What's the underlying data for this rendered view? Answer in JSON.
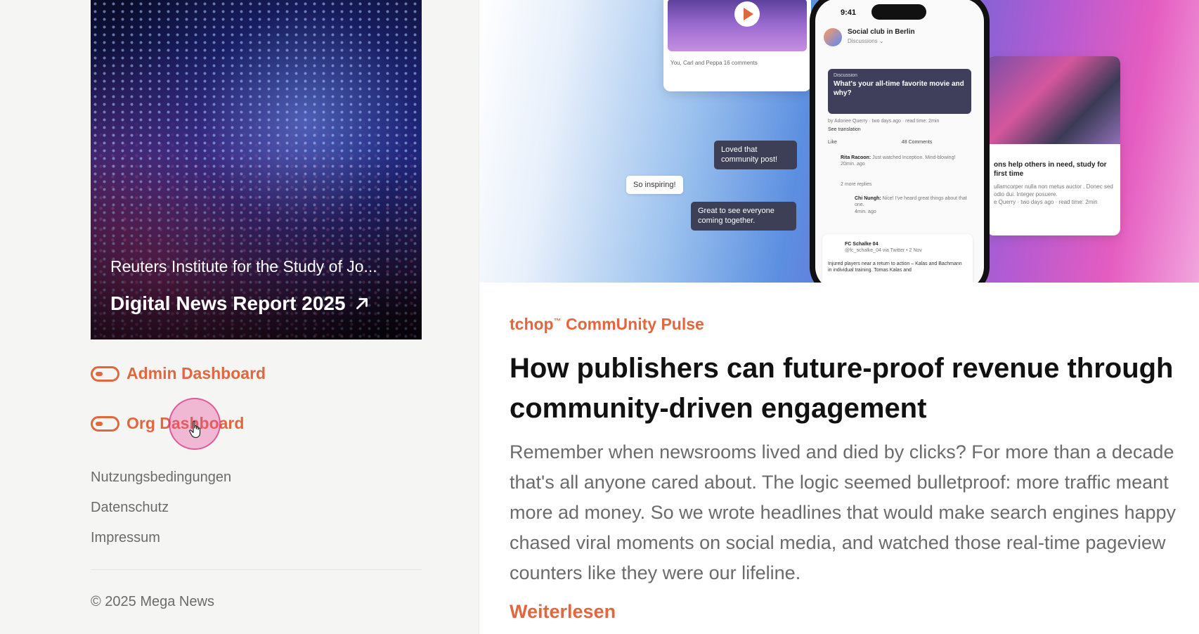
{
  "promo": {
    "source": "Reuters Institute for the Study of Jo...",
    "title": "Digital News Report 2025"
  },
  "dashboards": {
    "admin_label": "Admin Dashboard",
    "org_label": "Org Dashboard"
  },
  "footer": {
    "links": [
      "Nutzungsbedingungen",
      "Datenschutz",
      "Impressum"
    ],
    "copyright": "© 2025 Mega News"
  },
  "hero_mockup": {
    "phone_time": "9:41",
    "group_name": "Social club in Berlin",
    "group_sub": "Discussions ⌄",
    "discussion_tag": "Discussion",
    "discussion_question": "What's your all-time favorite movie and why?",
    "post_meta": "by Adoriee Querry · two days ago · read time: 2min",
    "see_translation": "See translation",
    "like": "Like",
    "comments": "48 Comments",
    "comment1_author": "Rita Racoon:",
    "comment1_text": "Just watched Inception. Mind-blowing!",
    "comment1_time": "20min. ago",
    "more_replies": "2 more replies",
    "comment2_author": "Chi Nungh:",
    "comment2_text": "Nice! I've heard great things about that one.",
    "comment2_time": "4min. ago",
    "card2_name": "FC Schalke 04",
    "card2_meta": "@fc_schalke_04 via Twitter • 2 Nov",
    "card2_text": "Injured players near a return to action – Kalas and Bachmann in individual training. Tomas Kalas and",
    "left_card_meta": "You, Carl and Peppa   16 comments",
    "right_card_title": "ons help others in need, study for first time",
    "right_card_text": "ullamcorper nulla non metus auctor . Donec sed odio dui. Integer posuere.",
    "right_card_meta": "e Querry · two days ago · read time: 2min",
    "bubble1": "Loved that community post!",
    "bubble2": "So inspiring!",
    "bubble3": "Great to see everyone coming together."
  },
  "article": {
    "kicker_main": "tchop",
    "kicker_tm": "™",
    "kicker_rest": " CommUnity Pulse",
    "title": "How publishers can future-proof revenue through community-driven engagement",
    "excerpt": "Remember when newsrooms lived and died by clicks? For more than a decade\nthat's all anyone cared about. The logic seemed bulletproof: more traffic meant\nmore ad money. So we wrote headlines that would make search engines happy\nchased viral moments on social media, and watched those real-time pageview\ncounters like they were our lifeline.",
    "read_more": "Weiterlesen"
  },
  "colors": {
    "accent": "#e2673f",
    "muted_text": "#6b6b6b",
    "cursor_highlight": "#ec4899"
  }
}
